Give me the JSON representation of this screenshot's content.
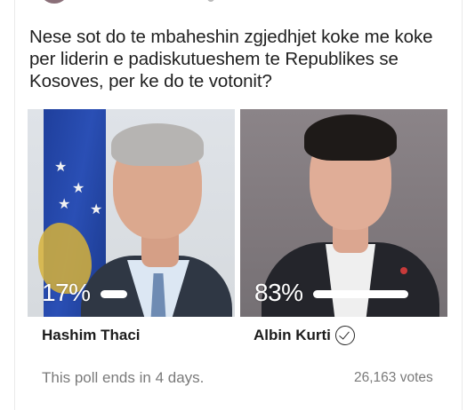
{
  "poll": {
    "question": "Nese sot do te mbaheshin zgjedhjet koke me koke per liderin e padiskutueshem te Republikes se Kosoves, per ke do te votonit?",
    "options": [
      {
        "name": "Hashim Thaci",
        "percent_label": "17%",
        "percent": 17,
        "selected": false
      },
      {
        "name": "Albin Kurti",
        "percent_label": "83%",
        "percent": 83,
        "selected": true
      }
    ],
    "status_text": "This poll ends in 4 days.",
    "votes_text": "26,163 votes"
  },
  "icons": {
    "selected": "check-circle-icon"
  },
  "colors": {
    "bar": "#ffffff",
    "flag_blue": "#244a9e",
    "flag_gold": "#d6b23a"
  }
}
